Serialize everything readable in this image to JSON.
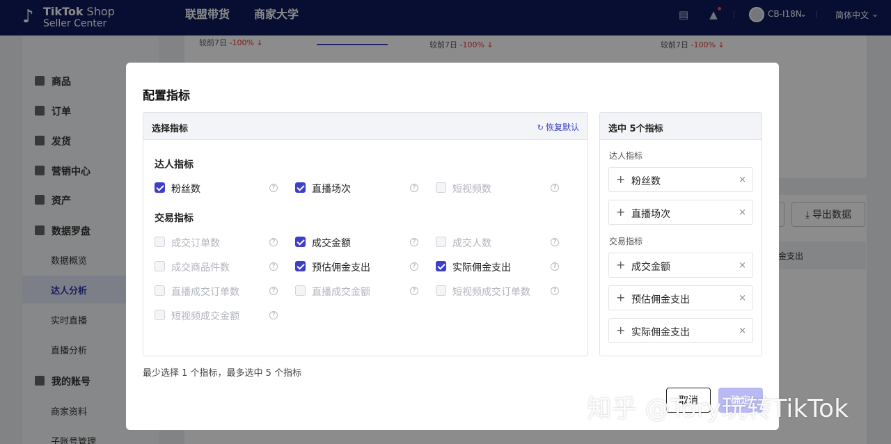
{
  "header": {
    "logo_line1_bold": "TikTok",
    "logo_line1_thin": " Shop",
    "logo_line2": "Seller Center",
    "nav": [
      "联盟带货",
      "商家大学"
    ],
    "account": "CB-I18N",
    "language": "简体中文",
    "icons": [
      "chat-icon",
      "bell-icon"
    ]
  },
  "sidebar": {
    "items": [
      {
        "label": "商品",
        "icon": "product-icon"
      },
      {
        "label": "订单",
        "icon": "order-icon"
      },
      {
        "label": "发货",
        "icon": "shipping-icon"
      },
      {
        "label": "营销中心",
        "icon": "marketing-icon"
      },
      {
        "label": "资产",
        "icon": "asset-icon"
      },
      {
        "label": "数据罗盘",
        "icon": "chart-icon"
      }
    ],
    "data_sub": [
      "数据概览",
      "达人分析",
      "实时直播",
      "直播分析"
    ],
    "active_sub": "达人分析",
    "account_item": {
      "label": "我的账号",
      "icon": "user-icon"
    },
    "account_sub": [
      "商家资料",
      "子账号管理"
    ]
  },
  "background": {
    "compare_label": "较前7日",
    "compare_values": [
      "-100%",
      "-100%",
      "-100%"
    ],
    "export_button": "导出数据",
    "table_head_partial": "金支出"
  },
  "modal": {
    "title": "配置指标",
    "left_title": "选择指标",
    "restore_label": "恢复默认",
    "groups": [
      {
        "title": "达人指标",
        "metrics": [
          {
            "label": "粉丝数",
            "checked": true,
            "disabled": false
          },
          {
            "label": "直播场次",
            "checked": true,
            "disabled": false
          },
          {
            "label": "短视频数",
            "checked": false,
            "disabled": true
          }
        ]
      },
      {
        "title": "交易指标",
        "metrics": [
          {
            "label": "成交订单数",
            "checked": false,
            "disabled": true
          },
          {
            "label": "成交金额",
            "checked": true,
            "disabled": false
          },
          {
            "label": "成交人数",
            "checked": false,
            "disabled": true
          },
          {
            "label": "成交商品件数",
            "checked": false,
            "disabled": true
          },
          {
            "label": "预估佣金支出",
            "checked": true,
            "disabled": false
          },
          {
            "label": "实际佣金支出",
            "checked": true,
            "disabled": false
          },
          {
            "label": "直播成交订单数",
            "checked": false,
            "disabled": true
          },
          {
            "label": "直播成交金额",
            "checked": false,
            "disabled": true
          },
          {
            "label": "短视频成交订单数",
            "checked": false,
            "disabled": true
          },
          {
            "label": "短视频成交金额",
            "checked": false,
            "disabled": true
          }
        ]
      }
    ],
    "right_title": "选中 5个指标",
    "selected_groups": [
      {
        "title": "达人指标",
        "items": [
          "粉丝数",
          "直播场次"
        ]
      },
      {
        "title": "交易指标",
        "items": [
          "成交金额",
          "预估佣金支出",
          "实际佣金支出"
        ]
      }
    ],
    "hint": "最少选择 1 个指标，最多选中 5 个指标",
    "cancel_label": "取消",
    "confirm_label": "确定"
  },
  "watermark": "知乎 @Tory玩转TikTok",
  "colors": {
    "header_bg": "#0d1a5c",
    "accent": "#3d3ec9",
    "confirm_disabled": "#b9b9f4",
    "negative": "#e3342f"
  }
}
